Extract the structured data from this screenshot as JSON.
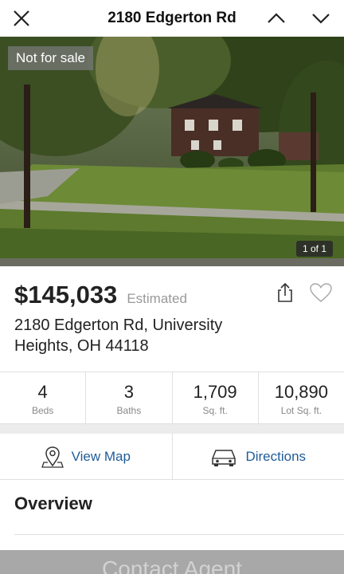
{
  "header": {
    "title": "2180 Edgerton Rd",
    "close_icon": "close-icon",
    "prev_icon": "chevron-up-icon",
    "next_icon": "chevron-down-icon"
  },
  "photo": {
    "badge": "Not for sale",
    "counter": "1 of 1"
  },
  "listing": {
    "price": "$145,033",
    "price_note": "Estimated",
    "address": "2180 Edgerton Rd, University Heights, OH 44118"
  },
  "stats": [
    {
      "value": "4",
      "label": "Beds"
    },
    {
      "value": "3",
      "label": "Baths"
    },
    {
      "value": "1,709",
      "label": "Sq. ft."
    },
    {
      "value": "10,890",
      "label": "Lot Sq. ft."
    }
  ],
  "actions": {
    "view_map": "View Map",
    "directions": "Directions"
  },
  "section": {
    "overview": "Overview"
  },
  "footer": {
    "contact_agent": "Contact Agent"
  },
  "colors": {
    "link": "#1f5c99",
    "contact_bar": "#a8a8a8"
  }
}
